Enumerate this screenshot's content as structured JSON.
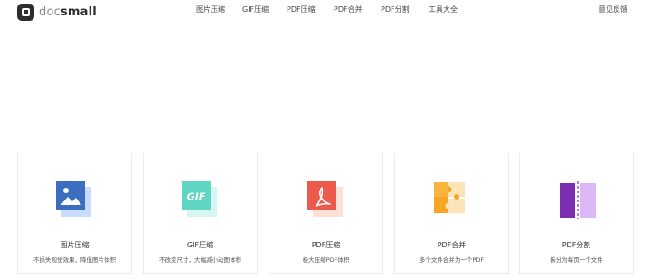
{
  "header": {
    "logo": {
      "doc": "doc",
      "small": "small"
    },
    "nav": [
      "图片压缩",
      "GIF压缩",
      "PDF压缩",
      "PDF合并",
      "PDF分割",
      "工具大全"
    ],
    "feedback": "意见反馈"
  },
  "cards": [
    {
      "icon": "image-icon",
      "title": "图片压缩",
      "desc": "不损失视觉效果，降低图片体积",
      "color": "#3c6dbf",
      "shadow": "#c9dcff"
    },
    {
      "icon": "gif-icon",
      "title": "GIF压缩",
      "desc": "不改变尺寸，大幅减小动图体积",
      "badge": "GIF",
      "color": "#5fd6c2",
      "shadow": "#d6f7f1"
    },
    {
      "icon": "pdf-icon",
      "title": "PDF压缩",
      "desc": "极大压缩PDF体积",
      "color": "#ec5a4b",
      "shadow": "#fde0d6"
    },
    {
      "icon": "puzzle-icon",
      "title": "PDF合并",
      "desc": "多个文件合并为一个PDF",
      "color": "#f6a623",
      "shadow": "#fde3b8"
    },
    {
      "icon": "split-icon",
      "title": "PDF分割",
      "desc": "拆分为每页一个文件",
      "color": "#7b2fb0",
      "shadow": "#ddb8f7"
    }
  ]
}
